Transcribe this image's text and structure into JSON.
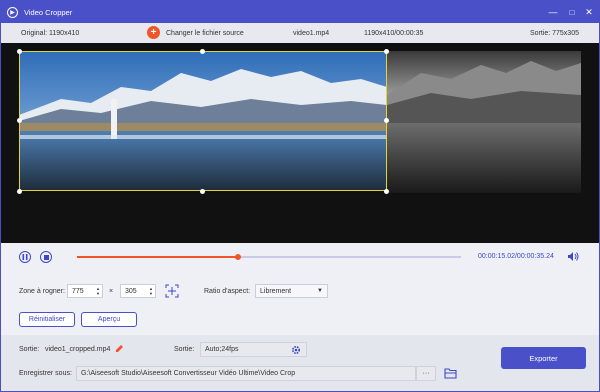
{
  "window": {
    "title": "Video Cropper"
  },
  "infobar": {
    "original": "Original: 1190x410",
    "change_source": "Changer le fichier source",
    "filename": "video1.mp4",
    "resolution_time": "1190x410/00:00:35",
    "output": "Sortie: 775x305"
  },
  "player": {
    "time": "00:00:15.02/00:00:35.24",
    "progress_fraction": 0.42
  },
  "crop": {
    "zone_label": "Zone à rogner:",
    "width": "775",
    "times": "×",
    "height": "305",
    "ratio_label": "Ratio d'aspect:",
    "ratio_value": "Librement",
    "reset_label": "Réinitialiser",
    "preview_label": "Aperçu"
  },
  "output": {
    "sortie_label": "Sortie:",
    "filename": "video1_cropped.mp4",
    "sortie2_label": "Sortie:",
    "format": "Auto;24fps",
    "save_label": "Enregistrer sous:",
    "path": "G:\\Aiseesoft Studio\\Aiseesoft Convertisseur Vidéo Ultime\\Video Crop",
    "more": "···",
    "export_label": "Exporter"
  },
  "colors": {
    "accent": "#4a50c8",
    "progress": "#f0552a",
    "crop": "#e6d530"
  },
  "icons": [
    "app-logo-icon",
    "minimize-icon",
    "close-icon",
    "add-icon",
    "pause-icon",
    "stop-icon",
    "volume-icon",
    "center-crop-icon",
    "edit-icon",
    "gear-icon",
    "folder-icon"
  ]
}
